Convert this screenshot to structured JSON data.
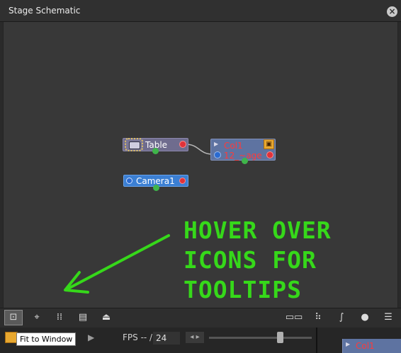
{
  "window": {
    "title": "Stage Schematic",
    "close_icon": "close-icon"
  },
  "nodes": {
    "table": {
      "label": "Table"
    },
    "col1": {
      "label": "Col1",
      "sublabel": "12_~age"
    },
    "camera": {
      "label": "Camera1"
    }
  },
  "annotation": {
    "lines": [
      "HOVER OVER",
      "ICONS FOR",
      "TOOLTIPS"
    ],
    "color": "#36d81a"
  },
  "toolbar": {
    "left_buttons": [
      "fit-to-window-icon",
      "focus-on-current-icon",
      "reorder-nodes-icon",
      "normal-size-icon",
      "preview-toggle-icon"
    ],
    "right_buttons": [
      "toggle-node-icons-icon",
      "output-ports-icon",
      "curve-links-icon",
      "switch-view-icon",
      "menu-icon"
    ],
    "tooltip": "Fit to Window"
  },
  "playback": {
    "fps_label": "FPS -- /",
    "fps_value": "24"
  },
  "background_node": {
    "label": "Col1"
  },
  "colors": {
    "canvas": "#383838",
    "table_node": "#6f6c8e",
    "col_node": "#5e73a1",
    "camera_node": "#3b7fd3",
    "port_red": "#e0323a",
    "port_green": "#3fb54a"
  }
}
